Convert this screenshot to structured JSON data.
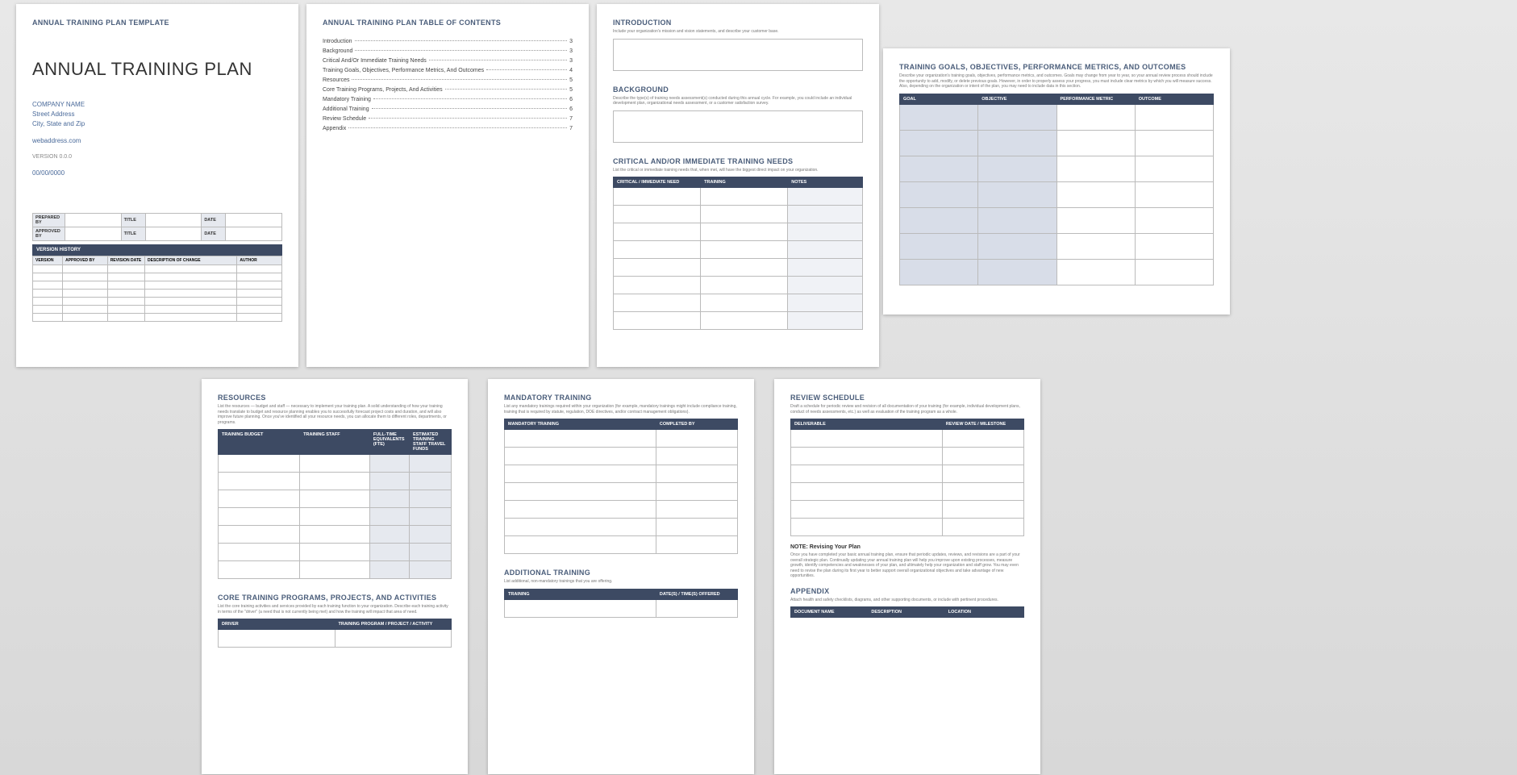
{
  "page1": {
    "header": "ANNUAL TRAINING PLAN TEMPLATE",
    "title": "ANNUAL TRAINING PLAN",
    "company": "COMPANY NAME",
    "street": "Street Address",
    "city": "City, State and Zip",
    "web": "webaddress.com",
    "version": "VERSION 0.0.0",
    "date": "00/00/0000",
    "meta": {
      "prepared": "PREPARED BY",
      "approved": "APPROVED BY",
      "titleLbl": "TITLE",
      "dateLbl": "DATE"
    },
    "vh": {
      "header": "VERSION HISTORY",
      "cols": [
        "VERSION",
        "APPROVED BY",
        "REVISION DATE",
        "DESCRIPTION OF CHANGE",
        "AUTHOR"
      ]
    }
  },
  "page2": {
    "title": "ANNUAL TRAINING PLAN TABLE OF CONTENTS",
    "items": [
      {
        "label": "Introduction",
        "page": "3"
      },
      {
        "label": "Background",
        "page": "3"
      },
      {
        "label": "Critical And/Or Immediate Training Needs",
        "page": "3"
      },
      {
        "label": "Training Goals, Objectives, Performance Metrics, And Outcomes",
        "page": "4"
      },
      {
        "label": "Resources",
        "page": "5"
      },
      {
        "label": "Core Training Programs, Projects, And Activities",
        "page": "5"
      },
      {
        "label": "Mandatory Training",
        "page": "6"
      },
      {
        "label": "Additional Training",
        "page": "6"
      },
      {
        "label": "Review Schedule",
        "page": "7"
      },
      {
        "label": "Appendix",
        "page": "7"
      }
    ]
  },
  "page3": {
    "intro": {
      "h": "INTRODUCTION",
      "d": "Include your organization's mission and vision statements, and describe your customer base."
    },
    "bg": {
      "h": "BACKGROUND",
      "d": "Describe the type(s) of training needs assessment(s) conducted during this annual cycle. For example, you could include an individual development plan, organizational needs assessment, or a customer satisfaction survey."
    },
    "crit": {
      "h": "CRITICAL AND/OR IMMEDIATE TRAINING NEEDS",
      "d": "List the critical or immediate training needs that, when met, will have the biggest direct impact on your organization.",
      "cols": [
        "CRITICAL / IMMEDIATE NEED",
        "TRAINING",
        "NOTES"
      ]
    }
  },
  "page4": {
    "h": "TRAINING GOALS, OBJECTIVES, PERFORMANCE METRICS, AND OUTCOMES",
    "d": "Describe your organization's training goals, objectives, performance metrics, and outcomes. Goals may change from year to year, so your annual review process should include the opportunity to add, modify, or delete previous goals. However, in order to properly assess your progress, you must include clear metrics by which you will measure success. Also, depending on the organization or intent of the plan, you may need to include data in this section.",
    "cols": [
      "GOAL",
      "OBJECTIVE",
      "PERFORMANCE METRIC",
      "OUTCOME"
    ]
  },
  "page5": {
    "res": {
      "h": "RESOURCES",
      "d": "List the resources — budget and staff — necessary to implement your training plan. A solid understanding of how your training needs translate to budget and resource planning enables you to successfully forecast project costs and duration, and will also improve future planning. Once you've identified all your resource needs, you can allocate them to different roles, departments, or programs.",
      "cols": [
        "TRAINING BUDGET",
        "TRAINING STAFF",
        "FULL-TIME EQUIVALENTS (FTE)",
        "ESTIMATED TRAINING STAFF TRAVEL FUNDS"
      ]
    },
    "core": {
      "h": "CORE TRAINING PROGRAMS, PROJECTS, AND ACTIVITIES",
      "d": "List the core training activities and services provided by each training function to your organization. Describe each training activity in terms of the \"driver\" (a need that is not currently being met) and how the training will impact that area of need.",
      "cols": [
        "DRIVER",
        "TRAINING PROGRAM / PROJECT / ACTIVITY"
      ]
    }
  },
  "page6": {
    "mand": {
      "h": "MANDATORY TRAINING",
      "d": "List any mandatory trainings required within your organization (for example, mandatory trainings might include compliance training, training that is required by statute, regulation, DOE directives, and/or contract management obligations).",
      "cols": [
        "MANDATORY TRAINING",
        "COMPLETED BY"
      ]
    },
    "add": {
      "h": "ADDITIONAL TRAINING",
      "d": "List additional, non-mandatory trainings that you are offering.",
      "cols": [
        "TRAINING",
        "DATE(S) / TIME(S) OFFERED"
      ]
    }
  },
  "page7": {
    "rev": {
      "h": "REVIEW SCHEDULE",
      "d": "Draft a schedule for periodic review and revision of all documentation of your training (for example, individual development plans, conduct of needs assessments, etc.) as well as evaluation of the training program as a whole.",
      "cols": [
        "DELIVERABLE",
        "REVIEW DATE / MILESTONE"
      ]
    },
    "note": {
      "h": "NOTE: Revising Your Plan",
      "d": "Once you have completed your basic annual training plan, ensure that periodic updates, reviews, and revisions are a part of your overall strategic plan. Continually updating your annual training plan will help you improve upon existing processes, measure growth, identify competencies and weaknesses of your plan, and ultimately help your organization and staff grow. You may even need to revise the plan during its first year to better support overall organizational objectives and take advantage of new opportunities."
    },
    "app": {
      "h": "APPENDIX",
      "d": "Attach health and safety checklists, diagrams, and other supporting documents, or include with pertinent procedures.",
      "cols": [
        "DOCUMENT NAME",
        "DESCRIPTION",
        "LOCATION"
      ]
    }
  }
}
